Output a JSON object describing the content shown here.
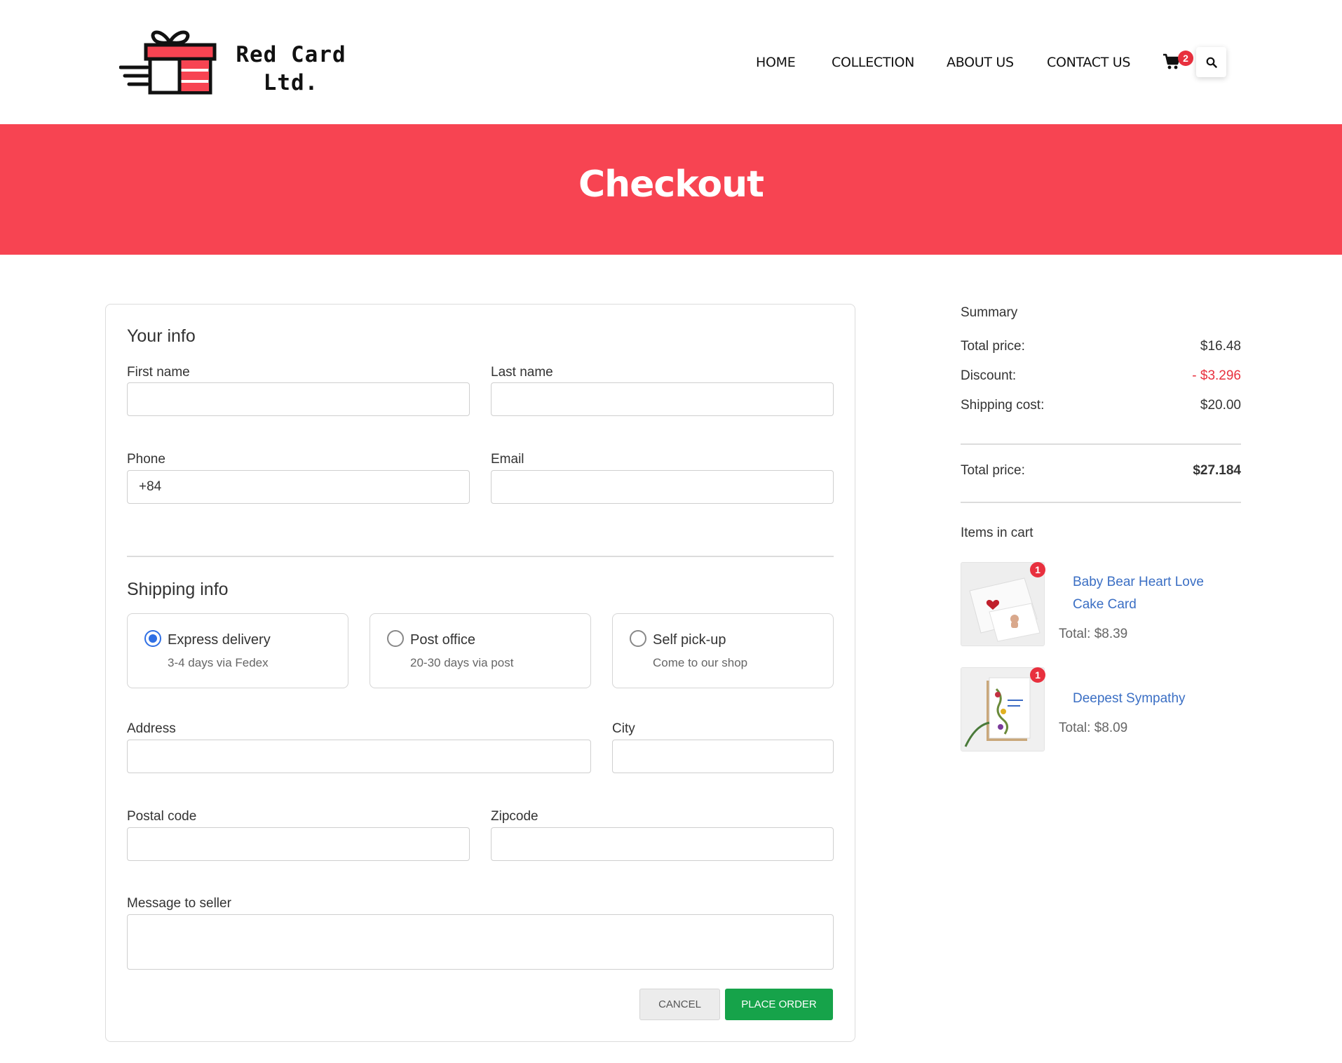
{
  "brand": {
    "name_line1": "Red Card",
    "name_line2": "Ltd.",
    "accent": "#f74452"
  },
  "nav": {
    "items": [
      "HOME",
      "COLLECTION",
      "ABOUT US",
      "CONTACT US"
    ],
    "cart_count": "2",
    "cart_icon": "cart-icon",
    "search_icon": "search-icon"
  },
  "banner": {
    "title": "Checkout"
  },
  "your_info": {
    "title": "Your info",
    "first_name_label": "First name",
    "first_name_value": "",
    "last_name_label": "Last name",
    "last_name_value": "",
    "phone_label": "Phone",
    "phone_value": "+84",
    "email_label": "Email",
    "email_value": ""
  },
  "shipping": {
    "title": "Shipping info",
    "options": [
      {
        "title": "Express delivery",
        "subtitle": "3-4 days via Fedex",
        "selected": true
      },
      {
        "title": "Post office",
        "subtitle": "20-30 days via post",
        "selected": false
      },
      {
        "title": "Self pick-up",
        "subtitle": "Come to our shop",
        "selected": false
      }
    ],
    "address_label": "Address",
    "city_label": "City",
    "postal_label": "Postal code",
    "zipcode_label": "Zipcode",
    "message_label": "Message to seller"
  },
  "actions": {
    "cancel": "CANCEL",
    "place_order": "PLACE ORDER",
    "place_order_color": "#16a34a"
  },
  "summary": {
    "title": "Summary",
    "total_price_label": "Total price:",
    "total_price": "$16.48",
    "discount_label": "Discount:",
    "discount": "- $3.296",
    "discount_color": "#e8303e",
    "shipping_label": "Shipping cost:",
    "shipping": "$20.00",
    "grand_total_label": "Total price:",
    "grand_total": "$27.184"
  },
  "cart": {
    "title": "Items in cart",
    "items": [
      {
        "name": "Baby Bear Heart Love Cake Card",
        "qty": "1",
        "total": "Total: $8.39"
      },
      {
        "name": "Deepest Sympathy",
        "qty": "1",
        "total": "Total: $8.09"
      }
    ]
  }
}
